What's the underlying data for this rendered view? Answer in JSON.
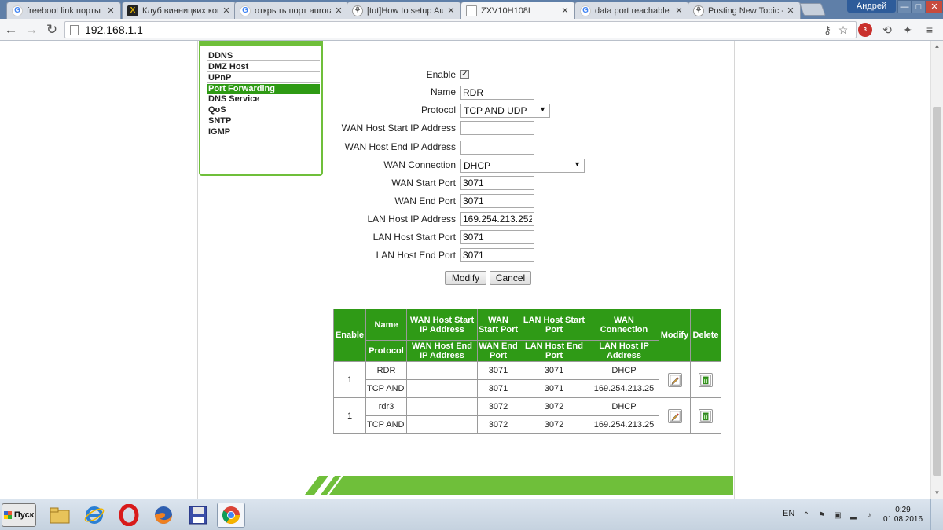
{
  "browser": {
    "tabs": [
      {
        "title": "freeboot link порты - ",
        "icon": "google-icon"
      },
      {
        "title": "Клуб винницких конс",
        "icon": "club-icon"
      },
      {
        "title": "открыть порт aurora",
        "icon": "google-icon"
      },
      {
        "title": "[tut]How to setup Aur",
        "icon": "forum-icon"
      },
      {
        "title": "ZXV10H108L",
        "icon": "page-icon"
      },
      {
        "title": "data port reachable fo",
        "icon": "google-icon"
      },
      {
        "title": "Posting New Topic - R",
        "icon": "forum-icon"
      }
    ],
    "active_tab": 4,
    "user_name": "Андрей",
    "window_controls": {
      "minimize": "—",
      "maximize": "□",
      "close": "✕"
    },
    "url": "192.168.1.1",
    "abp_count": "3"
  },
  "sidebar": {
    "items": [
      "DDNS",
      "DMZ Host",
      "UPnP",
      "Port Forwarding",
      "DNS Service",
      "QoS",
      "SNTP",
      "IGMP"
    ],
    "active": "Port Forwarding"
  },
  "form": {
    "enable_label": "Enable",
    "enable_checked": "✓",
    "name_label": "Name",
    "name_value": "RDR",
    "protocol_label": "Protocol",
    "protocol_value": "TCP AND UDP",
    "wan_start_ip_label": "WAN Host Start IP Address",
    "wan_start_ip_value": "",
    "wan_end_ip_label": "WAN Host End IP Address",
    "wan_end_ip_value": "",
    "wan_connection_label": "WAN Connection",
    "wan_connection_value": "DHCP",
    "wan_start_port_label": "WAN Start Port",
    "wan_start_port_value": "3071",
    "wan_end_port_label": "WAN End Port",
    "wan_end_port_value": "3071",
    "lan_ip_label": "LAN Host IP Address",
    "lan_ip_value": "169.254.213.252",
    "lan_start_port_label": "LAN Host Start Port",
    "lan_start_port_value": "3071",
    "lan_end_port_label": "LAN Host End Port",
    "lan_end_port_value": "3071",
    "modify_button": "Modify",
    "cancel_button": "Cancel"
  },
  "table": {
    "headers_row1": {
      "enable": "Enable",
      "name": "Name",
      "wan_start_ip": "WAN Host Start IP Address",
      "wan_start_port": "WAN Start Port",
      "lan_start_port": "LAN Host Start Port",
      "wan_connection": "WAN Connection",
      "modify": "Modify",
      "delete": "Delete"
    },
    "headers_row2": {
      "protocol": "Protocol",
      "wan_end_ip": "WAN Host End IP Address",
      "wan_end_port": "WAN End Port",
      "lan_end_port": "LAN Host End Port",
      "lan_ip": "LAN Host IP Address"
    },
    "rules": [
      {
        "enable": "1",
        "name": "RDR",
        "protocol": "TCP AND U",
        "wan_start_ip": "",
        "wan_end_ip": "",
        "wan_start_port": "3071",
        "wan_end_port": "3071",
        "lan_start_port": "3071",
        "lan_end_port": "3071",
        "wan_connection": "DHCP",
        "lan_ip": "169.254.213.25"
      },
      {
        "enable": "1",
        "name": "rdr3",
        "protocol": "TCP AND U",
        "wan_start_ip": "",
        "wan_end_ip": "",
        "wan_start_port": "3072",
        "wan_end_port": "3072",
        "lan_start_port": "3072",
        "lan_end_port": "3072",
        "wan_connection": "DHCP",
        "lan_ip": "169.254.213.25"
      }
    ]
  },
  "taskbar": {
    "start_label": "Пуск",
    "apps": [
      "explorer-icon",
      "internet-explorer-icon",
      "opera-icon",
      "firefox-icon",
      "floppy-app-icon",
      "chrome-icon"
    ],
    "language": "EN",
    "time": "0:29",
    "date": "01.08.2016"
  },
  "colors": {
    "accent_green": "#2f9a16",
    "light_green": "#6fbf3a"
  }
}
